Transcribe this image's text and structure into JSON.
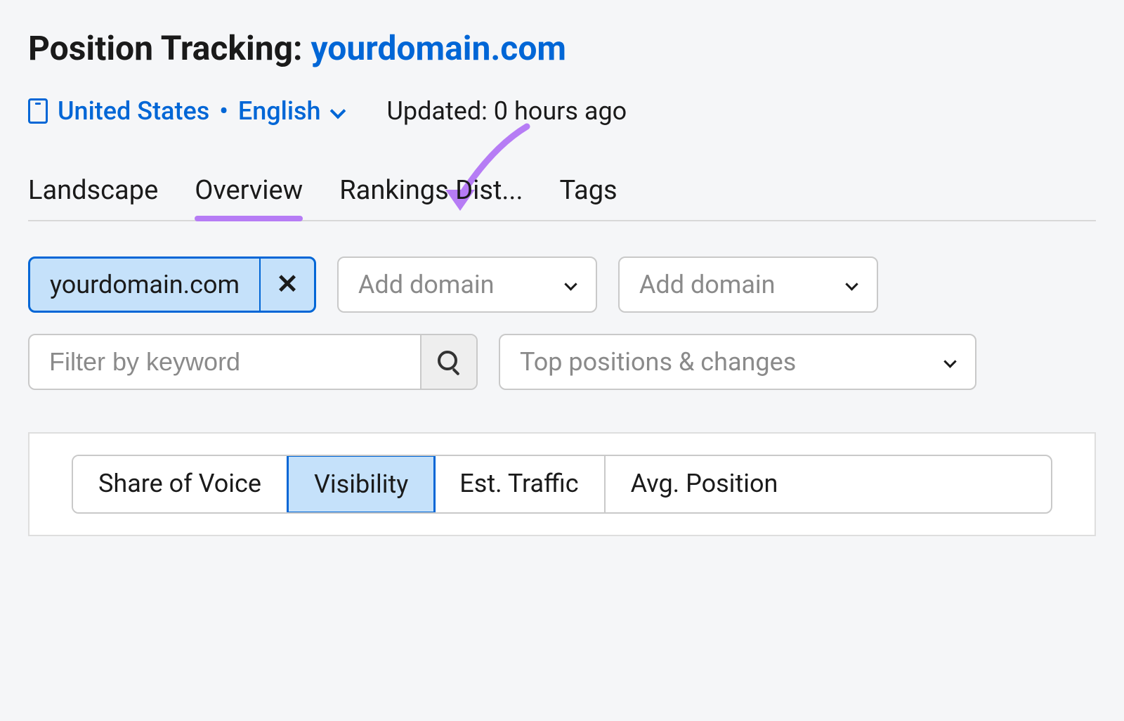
{
  "header": {
    "title_prefix": "Position Tracking: ",
    "domain": "yourdomain.com",
    "locale_country": "United States",
    "locale_bullet": " • ",
    "locale_language": "English",
    "updated_text": "Updated: 0 hours ago"
  },
  "tabs": [
    {
      "label": "Landscape",
      "active": false
    },
    {
      "label": "Overview",
      "active": true
    },
    {
      "label": "Rankings Dist...",
      "active": false
    },
    {
      "label": "Tags",
      "active": false
    }
  ],
  "domains": {
    "selected": "yourdomain.com",
    "add_placeholder_1": "Add domain",
    "add_placeholder_2": "Add domain"
  },
  "filters": {
    "keyword_placeholder": "Filter by keyword",
    "positions_dropdown": "Top positions & changes"
  },
  "metrics": [
    {
      "label": "Share of Voice",
      "active": false
    },
    {
      "label": "Visibility",
      "active": true
    },
    {
      "label": "Est. Traffic",
      "active": false
    },
    {
      "label": "Avg. Position",
      "active": false
    }
  ],
  "colors": {
    "primary": "#0066d6",
    "highlight": "#b67cf5",
    "chip_bg": "#c5e1fa"
  }
}
